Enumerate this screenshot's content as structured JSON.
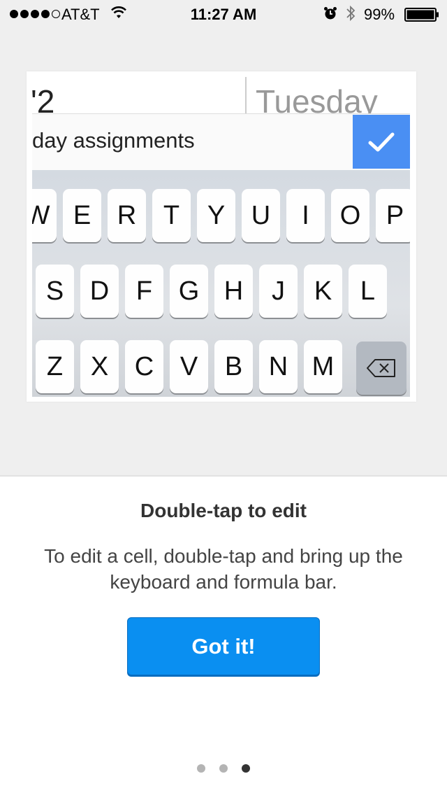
{
  "status_bar": {
    "carrier": "AT&T",
    "time": "11:27 AM",
    "battery": "99%",
    "signal_bars_filled": 4,
    "signal_bars_total": 5
  },
  "preview": {
    "cell_number": "'2",
    "cell_day": "Tuesday",
    "formula_text": "day assignments",
    "keyboard": {
      "row1": [
        "W",
        "E",
        "R",
        "T",
        "Y",
        "U",
        "I",
        "O",
        "P"
      ],
      "row2": [
        "S",
        "D",
        "F",
        "G",
        "H",
        "J",
        "K",
        "L"
      ],
      "row3": [
        "Z",
        "X",
        "C",
        "V",
        "B",
        "N",
        "M"
      ]
    }
  },
  "tutorial": {
    "heading": "Double-tap to edit",
    "description": "To edit a cell, double-tap and bring up the keyboard and formula bar.",
    "button_label": "Got it!",
    "page_count": 3,
    "active_page": 3
  },
  "colors": {
    "accent_button": "#0a8ff1",
    "confirm_button": "#4a8ff3",
    "background_top": "#efefef"
  }
}
